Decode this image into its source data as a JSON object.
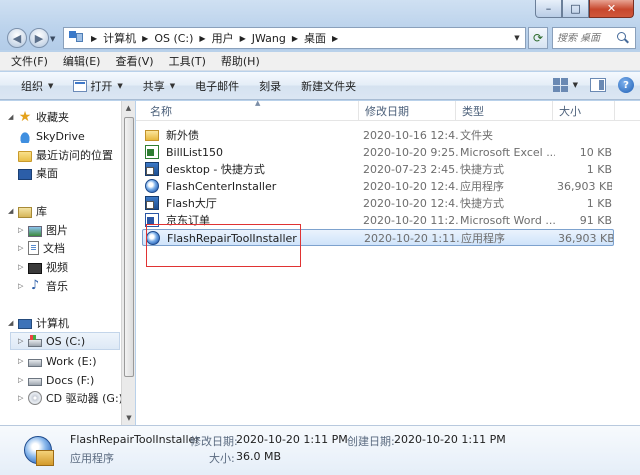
{
  "window": {
    "controls": {
      "minimize": "–",
      "maximize": "□",
      "close": "✕"
    }
  },
  "address": {
    "crumbs": [
      "计算机",
      "OS (C:)",
      "用户",
      "JWang",
      "桌面"
    ],
    "search_placeholder": "搜索 桌面"
  },
  "menu": [
    "文件(F)",
    "编辑(E)",
    "查看(V)",
    "工具(T)",
    "帮助(H)"
  ],
  "commands": {
    "organize": "组织",
    "open": "打开",
    "share": "共享",
    "email": "电子邮件",
    "burn": "刻录",
    "new_folder": "新建文件夹"
  },
  "nav": {
    "favorites": "收藏夹",
    "skydrive": "SkyDrive",
    "recent": "最近访问的位置",
    "desktop": "桌面",
    "libraries": "库",
    "pictures": "图片",
    "documents": "文档",
    "videos": "视频",
    "music": "音乐",
    "computer": "计算机",
    "drive_c": "OS (C:)",
    "drive_e": "Work (E:)",
    "drive_f": "Docs (F:)",
    "drive_g": "CD 驱动器 (G:) I"
  },
  "columns": {
    "name": "名称",
    "date": "修改日期",
    "type": "类型",
    "size": "大小"
  },
  "files": [
    {
      "name": "新外债",
      "date": "2020-10-16 12:4...",
      "type": "文件夹",
      "size": "",
      "icon": "folder-icon"
    },
    {
      "name": "BillList150",
      "date": "2020-10-20 9:25...",
      "type": "Microsoft Excel ...",
      "size": "10 KB",
      "icon": "excel-file-icon"
    },
    {
      "name": "desktop - 快捷方式",
      "date": "2020-07-23 2:45...",
      "type": "快捷方式",
      "size": "1 KB",
      "icon": "shortcut-icon"
    },
    {
      "name": "FlashCenterInstaller",
      "date": "2020-10-20 12:4...",
      "type": "应用程序",
      "size": "36,903 KB",
      "icon": "app-icon"
    },
    {
      "name": "Flash大厅",
      "date": "2020-10-20 12:4...",
      "type": "快捷方式",
      "size": "1 KB",
      "icon": "shortcut-icon"
    },
    {
      "name": "京东订单",
      "date": "2020-10-20 11:2...",
      "type": "Microsoft Word ...",
      "size": "91 KB",
      "icon": "word-file-icon"
    },
    {
      "name": "FlashRepairToolInstaller",
      "date": "2020-10-20 1:11...",
      "type": "应用程序",
      "size": "36,903 KB",
      "icon": "app-icon"
    }
  ],
  "details": {
    "name": "FlashRepairToolInstaller",
    "type": "应用程序",
    "modified_label": "修改日期:",
    "modified_value": "2020-10-20 1:11 PM",
    "created_label": "创建日期:",
    "created_value": "2020-10-20 1:11 PM",
    "size_label": "大小:",
    "size_value": "36.0 MB"
  },
  "colors": {
    "selection_border": "#7da2ce",
    "highlight_box": "#e03333"
  }
}
